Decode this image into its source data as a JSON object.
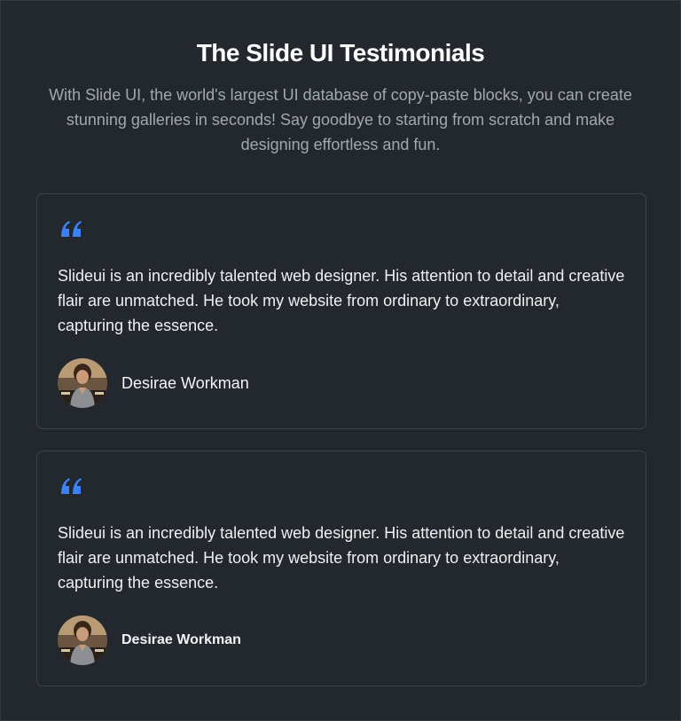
{
  "header": {
    "title": "The Slide UI Testimonials",
    "subtitle": "With Slide UI, the world's largest UI database of copy-paste blocks, you can create stunning galleries in seconds! Say goodbye to starting from scratch and make designing effortless and fun."
  },
  "testimonials": [
    {
      "quote": "Slideui is an incredibly talented web designer. His attention to detail and creative flair are unmatched. He took my website from ordinary to extraordinary, capturing the essence.",
      "author": "Desirae Workman",
      "icon": "quote-icon"
    },
    {
      "quote": "Slideui is an incredibly talented web designer. His attention to detail and creative flair are unmatched. He took my website from ordinary to extraordinary, capturing the essence.",
      "author": "Desirae Workman",
      "icon": "quote-icon"
    }
  ],
  "colors": {
    "background": "#23272e",
    "card_border": "#3d4249",
    "accent_quote": "#3b82f6",
    "subtitle": "#a3a8b0"
  }
}
